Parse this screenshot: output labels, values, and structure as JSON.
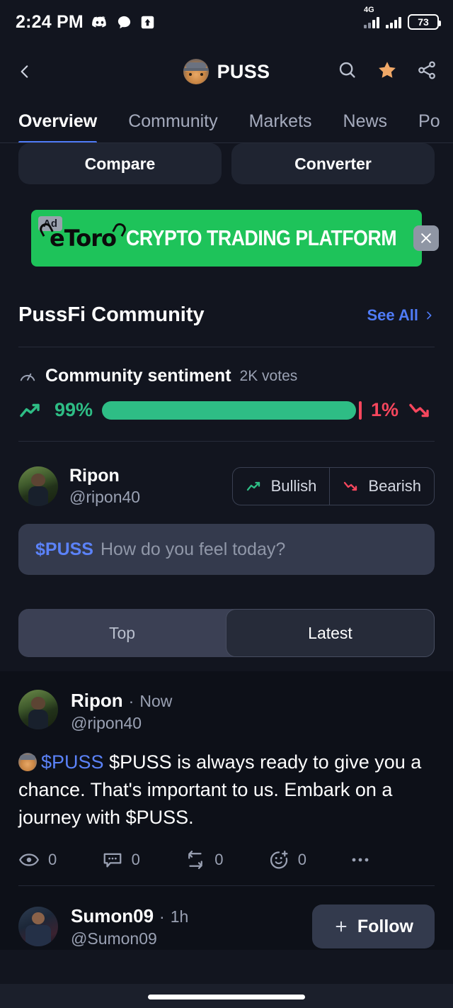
{
  "status_bar": {
    "time": "2:24 PM",
    "icons": [
      "discord-icon",
      "messages-bubble-icon",
      "upload-arrow-icon"
    ],
    "network_label": "4G",
    "battery_level": "73"
  },
  "header": {
    "back_icon": "chevron-left-icon",
    "logo_icon": "puss-cat-logo",
    "ticker": "PUSS",
    "actions": [
      "search-icon",
      "star-favorite-icon",
      "share-icon"
    ]
  },
  "tabs": [
    {
      "label": "Overview",
      "active": true
    },
    {
      "label": "Community",
      "active": false
    },
    {
      "label": "Markets",
      "active": false
    },
    {
      "label": "News",
      "active": false
    },
    {
      "label": "Po",
      "active": false
    }
  ],
  "quick_actions": {
    "compare": "Compare",
    "converter": "Converter"
  },
  "ad": {
    "badge": "Ad",
    "brand": "eToro",
    "headline": "CRYPTO TRADING PLATFORM",
    "close_icon": "close-x-icon",
    "background_color": "#1ec35a"
  },
  "community": {
    "title": "PussFi Community",
    "see_all": "See All",
    "see_all_icon": "chevron-right-icon",
    "sentiment": {
      "gauge_icon": "gauge-icon",
      "label": "Community sentiment",
      "votes": "2K votes",
      "bullish_pct": "99%",
      "bearish_pct": "1%",
      "bullish_value": 99,
      "bearish_value": 1,
      "bullish_color": "#2ebd85",
      "bearish_color": "#f6465d",
      "up_icon": "trend-up-icon",
      "down_icon": "trend-down-icon"
    },
    "current_user": {
      "avatar": "ripon-avatar",
      "name": "Ripon",
      "handle": "@ripon40",
      "bullish_label": "Bullish",
      "bearish_label": "Bearish"
    },
    "composer": {
      "tag": "$PUSS",
      "placeholder": "How do you feel today?"
    },
    "feed_tabs": [
      {
        "label": "Top",
        "active": false
      },
      {
        "label": "Latest",
        "active": true
      }
    ]
  },
  "posts": [
    {
      "avatar": "ripon-avatar",
      "name": "Ripon",
      "separator": "·",
      "time": "Now",
      "handle": "@ripon40",
      "emoji": "cat-cowboy-emoji",
      "cashtag": "$PUSS",
      "text": "$PUSS is always ready to give you a chance. That's important to us.  Embark on a journey with $PUSS.",
      "actions": [
        {
          "icon": "eye-views-icon",
          "count": "0"
        },
        {
          "icon": "comment-bubble-icon",
          "count": "0"
        },
        {
          "icon": "repost-icon",
          "count": "0"
        },
        {
          "icon": "emoji-react-icon",
          "count": "0"
        },
        {
          "icon": "more-dots-icon",
          "count": ""
        }
      ]
    },
    {
      "avatar": "sumon-avatar",
      "name": "Sumon09",
      "separator": "·",
      "time": "1h",
      "handle": "@Sumon09",
      "follow_label": "Follow",
      "follow_icon": "plus-icon"
    }
  ],
  "theme": {
    "background": "#12151f",
    "feed_background": "#0d1018",
    "accent_blue": "#4f7bf7",
    "green": "#2ebd85",
    "red": "#f6465d",
    "star_orange": "#f0a868"
  }
}
